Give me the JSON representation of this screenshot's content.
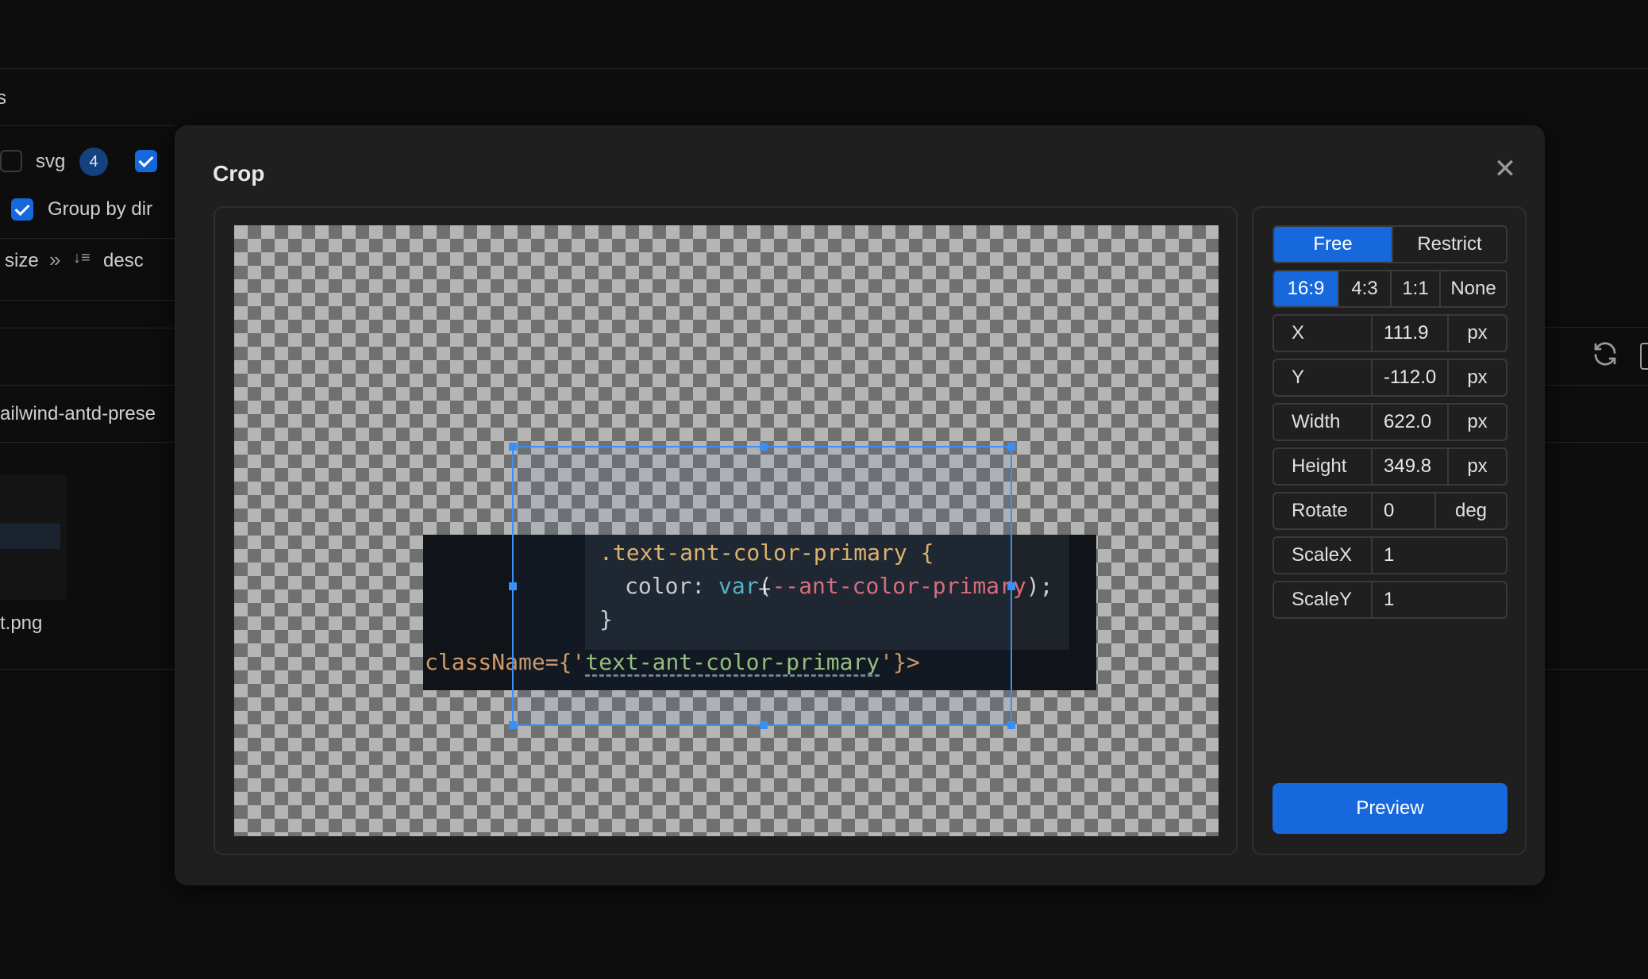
{
  "background": {
    "partial_header": "s",
    "filters": {
      "svg_label": "svg",
      "svg_count": "4",
      "group_by_dir": "Group by dir"
    },
    "sort": {
      "field": "size",
      "arrow": "»",
      "order": "desc"
    },
    "folder_name": "ailwind-antd-prese",
    "file_name": "t.png"
  },
  "modal": {
    "title": "Crop",
    "close_glyph": "✕",
    "code_preview": {
      "line1": ".text-ant-color-primary {",
      "line2_prop": "color: ",
      "line2_fn": "var",
      "line2_paren": "(",
      "line2_var": "--ant-color-primary",
      "line2_end": ");",
      "line3": "}",
      "line4_attr": "className={'",
      "line4_str": "text-ant-color-primary",
      "line4_end": "'}>"
    },
    "mode": {
      "options": [
        "Free",
        "Restrict"
      ],
      "selected": "Free"
    },
    "aspect": {
      "options": [
        "16:9",
        "4:3",
        "1:1",
        "None"
      ],
      "selected": "16:9"
    },
    "fields": {
      "x": {
        "label": "X",
        "value": "111.9",
        "unit": "px"
      },
      "y": {
        "label": "Y",
        "value": "-112.0",
        "unit": "px"
      },
      "width": {
        "label": "Width",
        "value": "622.0",
        "unit": "px"
      },
      "height": {
        "label": "Height",
        "value": "349.8",
        "unit": "px"
      },
      "rotate": {
        "label": "Rotate",
        "value": "0",
        "unit": "deg"
      },
      "scalex": {
        "label": "ScaleX",
        "value": "1"
      },
      "scaley": {
        "label": "ScaleY",
        "value": "1"
      }
    },
    "preview_label": "Preview",
    "accent_color": "#1668dc",
    "crop_color": "#3b8ff2"
  }
}
